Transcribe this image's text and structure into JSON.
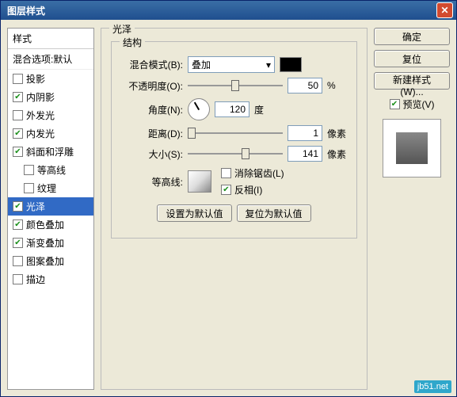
{
  "window": {
    "title": "图层样式"
  },
  "left": {
    "header": "样式",
    "sub": "混合选项:默认",
    "items": [
      {
        "label": "投影",
        "checked": false,
        "indent": false
      },
      {
        "label": "内阴影",
        "checked": true,
        "indent": false
      },
      {
        "label": "外发光",
        "checked": false,
        "indent": false
      },
      {
        "label": "内发光",
        "checked": true,
        "indent": false
      },
      {
        "label": "斜面和浮雕",
        "checked": true,
        "indent": false
      },
      {
        "label": "等高线",
        "checked": false,
        "indent": true
      },
      {
        "label": "纹理",
        "checked": false,
        "indent": true
      },
      {
        "label": "光泽",
        "checked": true,
        "indent": false,
        "selected": true
      },
      {
        "label": "颜色叠加",
        "checked": true,
        "indent": false
      },
      {
        "label": "渐变叠加",
        "checked": true,
        "indent": false
      },
      {
        "label": "图案叠加",
        "checked": false,
        "indent": false
      },
      {
        "label": "描边",
        "checked": false,
        "indent": false
      }
    ]
  },
  "panel": {
    "title": "光泽",
    "struct_title": "结构",
    "blend_label": "混合模式(B):",
    "blend_value": "叠加",
    "opacity_label": "不透明度(O):",
    "opacity_value": "50",
    "opacity_unit": "%",
    "angle_label": "角度(N):",
    "angle_value": "120",
    "angle_unit": "度",
    "dist_label": "距离(D):",
    "dist_value": "1",
    "dist_unit": "像素",
    "size_label": "大小(S):",
    "size_value": "141",
    "size_unit": "像素",
    "contour_label": "等高线:",
    "antialias_label": "消除锯齿(L)",
    "invert_label": "反相(I)",
    "btn_default": "设置为默认值",
    "btn_reset": "复位为默认值"
  },
  "right": {
    "ok": "确定",
    "cancel": "复位",
    "newstyle": "新建样式(W)...",
    "preview_label": "预览(V)"
  },
  "corner": "jb51.net"
}
